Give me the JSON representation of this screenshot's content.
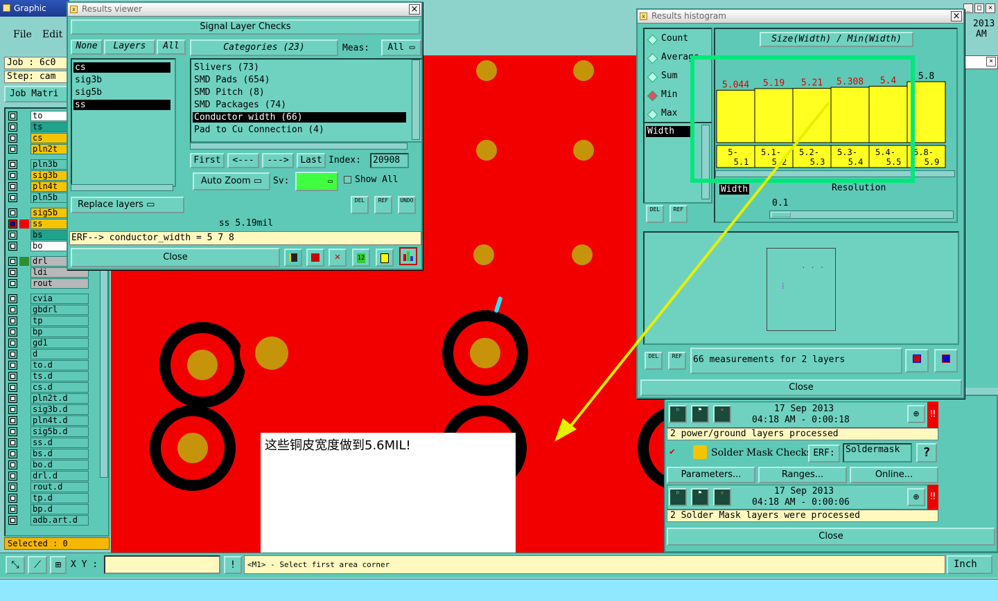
{
  "main_window": {
    "title": "Graphic Edito",
    "menu": {
      "file": "File",
      "edit": "Edit"
    },
    "job_label": "Job : 6c0",
    "step_label": "Step: cam",
    "job_matrix": "Job Matri",
    "layers": [
      {
        "name": "to",
        "color": "#ffffff",
        "swatch": ""
      },
      {
        "name": "ts",
        "color": "#1fa38d",
        "swatch": ""
      },
      {
        "name": "cs",
        "color": "#f5c400",
        "swatch": ""
      },
      {
        "name": "pln2t",
        "color": "#f5c400",
        "swatch": ""
      },
      {
        "name": "pln3b",
        "color": "#5ec9b6",
        "swatch": ""
      },
      {
        "name": "sig3b",
        "color": "#f5c400",
        "swatch": ""
      },
      {
        "name": "pln4t",
        "color": "#f5c400",
        "swatch": ""
      },
      {
        "name": "pln5b",
        "color": "#5ec9b6",
        "swatch": ""
      },
      {
        "name": "sig5b",
        "color": "#f5c400",
        "swatch": ""
      },
      {
        "name": "ss",
        "color": "#f5c400",
        "swatch": "#f20000"
      },
      {
        "name": "bs",
        "color": "#1fa38d",
        "swatch": ""
      },
      {
        "name": "bo",
        "color": "#ffffff",
        "swatch": ""
      },
      {
        "name": "drl",
        "color": "#b8b8b8",
        "swatch": "#2f8f2f"
      },
      {
        "name": "ldi",
        "color": "#b8b8b8",
        "swatch": ""
      },
      {
        "name": "rout",
        "color": "#b8b8b8",
        "swatch": ""
      },
      {
        "name": "cvia",
        "color": "#5ec9b6",
        "swatch": ""
      },
      {
        "name": "gbdrl",
        "color": "#5ec9b6",
        "swatch": ""
      },
      {
        "name": "tp",
        "color": "#5ec9b6",
        "swatch": ""
      },
      {
        "name": "bp",
        "color": "#5ec9b6",
        "swatch": ""
      },
      {
        "name": "gd1",
        "color": "#5ec9b6",
        "swatch": ""
      },
      {
        "name": "d",
        "color": "#5ec9b6",
        "swatch": ""
      },
      {
        "name": "to.d",
        "color": "#5ec9b6",
        "swatch": ""
      },
      {
        "name": "ts.d",
        "color": "#5ec9b6",
        "swatch": ""
      },
      {
        "name": "cs.d",
        "color": "#5ec9b6",
        "swatch": ""
      },
      {
        "name": "pln2t.d",
        "color": "#5ec9b6",
        "swatch": ""
      },
      {
        "name": "sig3b.d",
        "color": "#5ec9b6",
        "swatch": ""
      },
      {
        "name": "pln4t.d",
        "color": "#5ec9b6",
        "swatch": ""
      },
      {
        "name": "sig5b.d",
        "color": "#5ec9b6",
        "swatch": ""
      },
      {
        "name": "ss.d",
        "color": "#5ec9b6",
        "swatch": ""
      },
      {
        "name": "bs.d",
        "color": "#5ec9b6",
        "swatch": ""
      },
      {
        "name": "bo.d",
        "color": "#5ec9b6",
        "swatch": ""
      },
      {
        "name": "drl.d",
        "color": "#5ec9b6",
        "swatch": ""
      },
      {
        "name": "rout.d",
        "color": "#5ec9b6",
        "swatch": ""
      },
      {
        "name": "tp.d",
        "color": "#5ec9b6",
        "swatch": ""
      },
      {
        "name": "bp.d",
        "color": "#5ec9b6",
        "swatch": ""
      },
      {
        "name": "adb.art.d",
        "color": "#5ec9b6",
        "swatch": ""
      }
    ],
    "selected_count": "Selected : 0",
    "xy_label": "X Y :",
    "xy_value": "",
    "status_message": "<M1> - Select first area corner",
    "units": "Inch",
    "annotation_text": "这些铜皮宽度做到5.6MIL!"
  },
  "results_viewer": {
    "title": "Results viewer",
    "header": "Signal Layer Checks",
    "layer_filters": {
      "none": "None",
      "layers": "Layers",
      "all": "All"
    },
    "layers": [
      "cs",
      "sig3b",
      "sig5b",
      "ss"
    ],
    "categories_header": "Categories (23)",
    "meas_label": "Meas:",
    "meas_value": "All",
    "categories": [
      "Slivers (73)",
      "SMD Pads (654)",
      "SMD Pitch (8)",
      "SMD Packages (74)",
      "Conductor width (66)",
      "Pad to Cu Connection (4)"
    ],
    "selected_category": "Conductor width (66)",
    "nav": {
      "first": "First",
      "prev": "<---",
      "next": "--->",
      "last": "Last"
    },
    "index_label": "Index:",
    "index_value": "20908",
    "auto_zoom": "Auto Zoom",
    "sv_label": "Sv:",
    "show_all": "Show All",
    "replace_layers": "Replace layers",
    "status": "ss 5.19mil",
    "erf": "ERF--> conductor_width = 5 7 8",
    "close": "Close",
    "icon_labels": {
      "del": "DEL",
      "ref": "REF",
      "undo": "UNDO"
    }
  },
  "results_histogram": {
    "title": "Results histogram",
    "stat_options": [
      "Count",
      "Average",
      "Sum",
      "Min",
      "Max"
    ],
    "selected_stat": "Min",
    "field_list": [
      "Width"
    ],
    "histogram_title": "Size(Width) / Min(Width)",
    "width_label": "Width",
    "resolution_label": "Resolution",
    "resolution_value": "0.1",
    "measurements": "66 measurements for 2 layers",
    "close": "Close"
  },
  "chart_data": {
    "type": "bar",
    "title": "Size(Width) / Min(Width)",
    "categories": [
      "5-5.1",
      "5.1-5.2",
      "5.2-5.3",
      "5.3-5.4",
      "5.4-5.5",
      "5.8-5.9"
    ],
    "category_labels": [
      [
        "5-",
        "5.1"
      ],
      [
        "5.1-",
        "5.2"
      ],
      [
        "5.2-",
        "5.3"
      ],
      [
        "5.3-",
        "5.4"
      ],
      [
        "5.4-",
        "5.5"
      ],
      [
        "5.8-",
        "5.9"
      ]
    ],
    "values": [
      5.044,
      5.19,
      5.21,
      5.308,
      5.4,
      5.8
    ],
    "value_labels": [
      "5.044",
      "5.19",
      "5.21",
      "5.308",
      "5.4",
      "5.8"
    ],
    "bar_color": "#ffff20",
    "label_color": "#e00000"
  },
  "checklist": {
    "date": "17 Sep 2013",
    "time1": "04:18 AM - 0:00:18",
    "msg1": "2 power/ground layers processed",
    "solder_mask": "Solder Mask Checks",
    "erf_label": "ERF:",
    "erf_value": "Soldermask",
    "help": "?",
    "parameters": "Parameters...",
    "ranges": "Ranges...",
    "online": "Online...",
    "date2": "17 Sep 2013",
    "time2": "04:18 AM - 0:00:06",
    "msg2": "2 Solder Mask layers were processed",
    "close": "Close",
    "bg_date": "2013",
    "bg_time": "AM"
  }
}
